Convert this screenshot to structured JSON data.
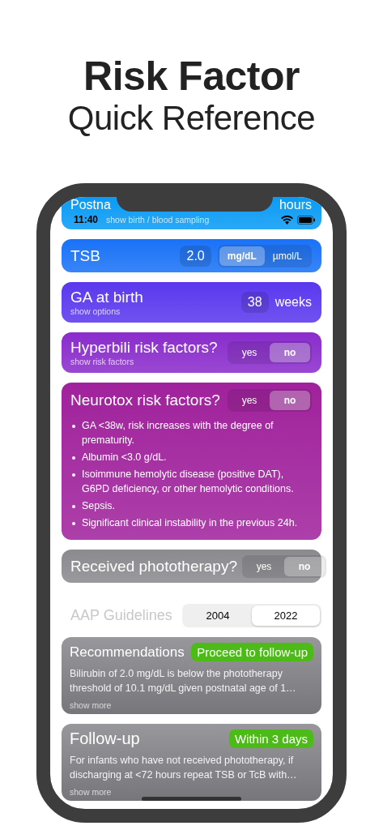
{
  "headline": {
    "title": "Risk Factor",
    "subtitle": "Quick Reference"
  },
  "status_bar": {
    "time": "11:40"
  },
  "cards": [
    {
      "kind": "number",
      "title": "Postna",
      "hint": "show birth / blood sampling",
      "unit": "hours",
      "color": "#0a9bf5"
    },
    {
      "kind": "units",
      "title": "TSB",
      "value": "2.0",
      "options": [
        {
          "label": "mg/dL",
          "selected": true
        },
        {
          "label": "µmol/L",
          "selected": false
        }
      ],
      "color": "#1a72f7"
    },
    {
      "kind": "number",
      "title": "GA at birth",
      "hint": "show options",
      "value": "38",
      "unit": "weeks",
      "color": "#5a38ee"
    },
    {
      "kind": "toggle",
      "title": "Hyperbili risk factors?",
      "hint": "show risk factors",
      "options": [
        {
          "label": "yes",
          "selected": false
        },
        {
          "label": "no",
          "selected": true
        }
      ],
      "color": "#8a2ccc"
    },
    {
      "kind": "toggle",
      "title": "Neurotox risk factors?",
      "options": [
        {
          "label": "yes",
          "selected": false
        },
        {
          "label": "no",
          "selected": true
        }
      ],
      "color": "#a0229c",
      "items": [
        "GA <38w, risk increases with the degree of prematurity.",
        "Albumin <3.0 g/dL.",
        "Isoimmune hemolytic disease (positive DAT), G6PD deficiency, or other hemolytic conditions.",
        "Sepsis.",
        "Significant clinical instability in the previous 24h."
      ]
    },
    {
      "kind": "toggle",
      "title": "Received phototherapy?",
      "options": [
        {
          "label": "yes",
          "selected": false
        },
        {
          "label": "no",
          "selected": true
        }
      ],
      "color": "#8a8a8f"
    }
  ],
  "guidelines": {
    "label": "AAP Guidelines",
    "options": [
      {
        "label": "2004",
        "selected": false
      },
      {
        "label": "2022",
        "selected": true
      }
    ]
  },
  "results": [
    {
      "title": "Recommendations",
      "badge": "Proceed to follow-up",
      "text": "Bilirubin of 2.0 mg/dL is below the phototherapy threshold of 10.1 mg/dL given postnatal age of 1…",
      "link": "show more"
    },
    {
      "title": "Follow-up",
      "badge": "Within 3 days",
      "text": "For infants who have not received phototherapy, if discharging at <72 hours repeat TSB or TcB with…",
      "link": "show more"
    }
  ]
}
